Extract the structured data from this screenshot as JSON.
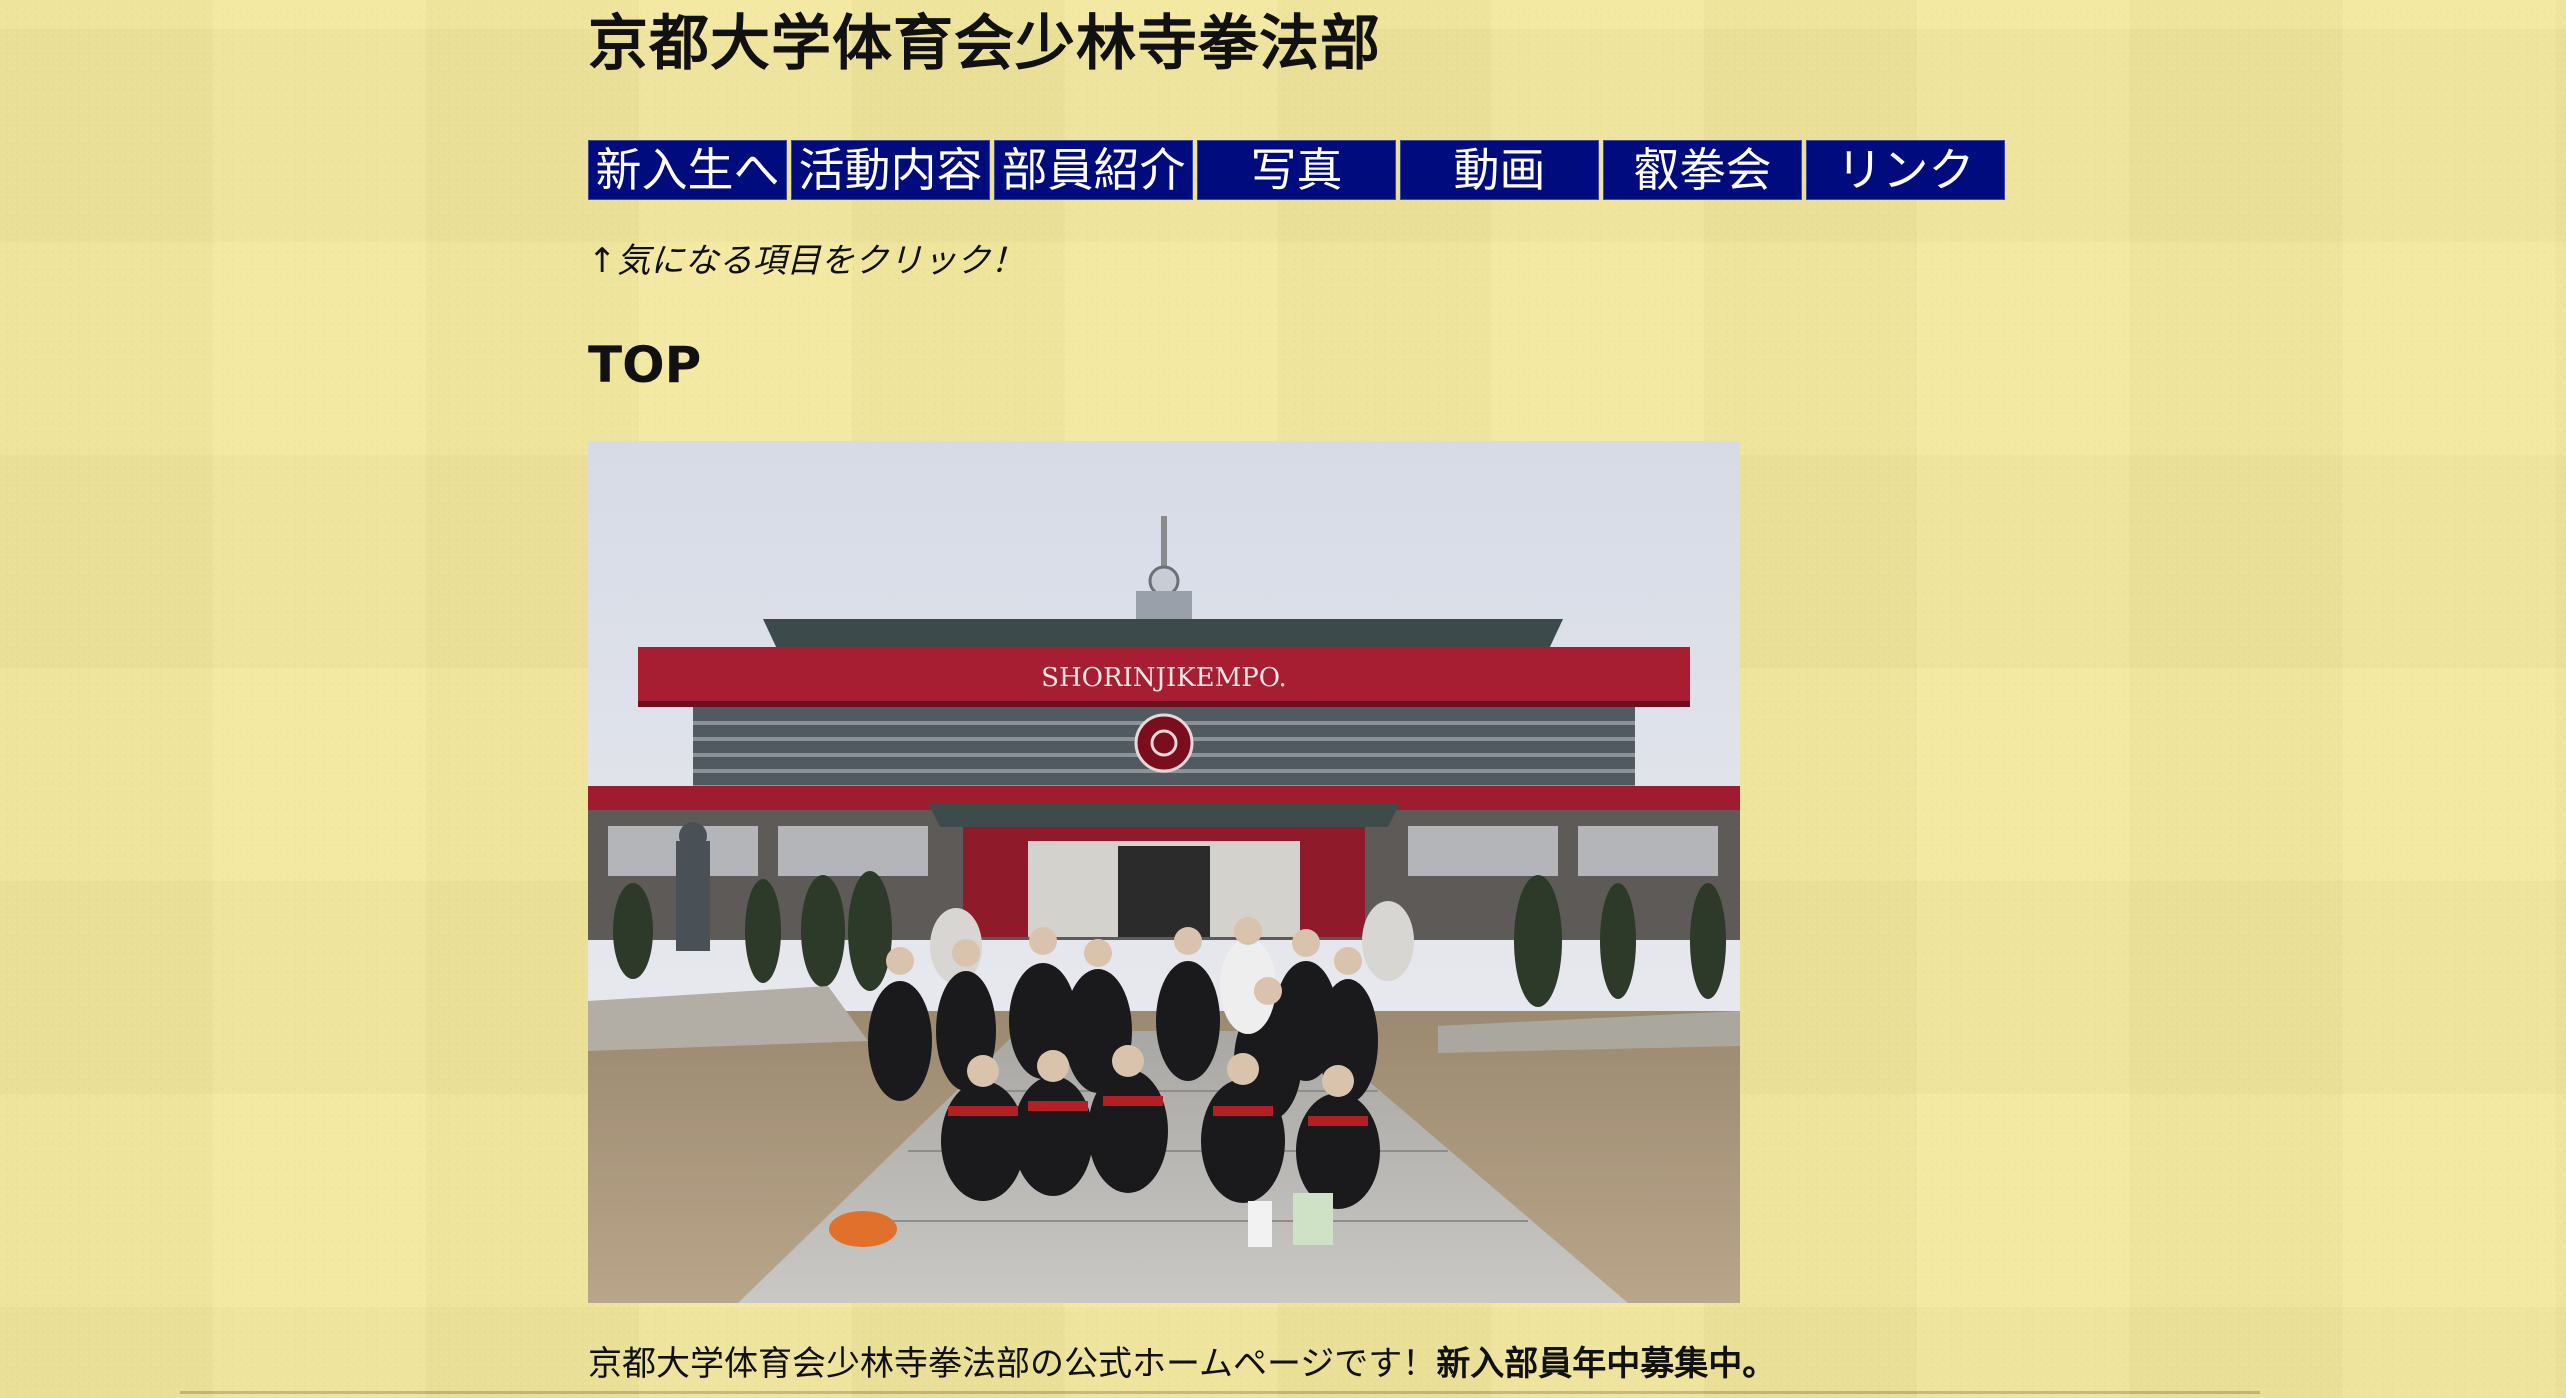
{
  "site": {
    "title": "京都大学体育会少林寺拳法部"
  },
  "nav": {
    "items": [
      {
        "label": "新入生へ"
      },
      {
        "label": "活動内容"
      },
      {
        "label": "部員紹介"
      },
      {
        "label": "写真"
      },
      {
        "label": "動画"
      },
      {
        "label": "叡拳会"
      },
      {
        "label": "リンク"
      }
    ]
  },
  "main": {
    "hint": "↑気になる項目をクリック！",
    "heading": "TOP",
    "photo": {
      "sign_text": "SHORINJIKEMPO."
    },
    "intro_text": "京都大学体育会少林寺拳法部の公式ホームページです！",
    "intro_bold": "新入部員年中募集中。"
  },
  "colors": {
    "background": "#f2e79a",
    "nav_bg": "#000c7d",
    "nav_text": "#ffffff",
    "text": "#111111"
  }
}
